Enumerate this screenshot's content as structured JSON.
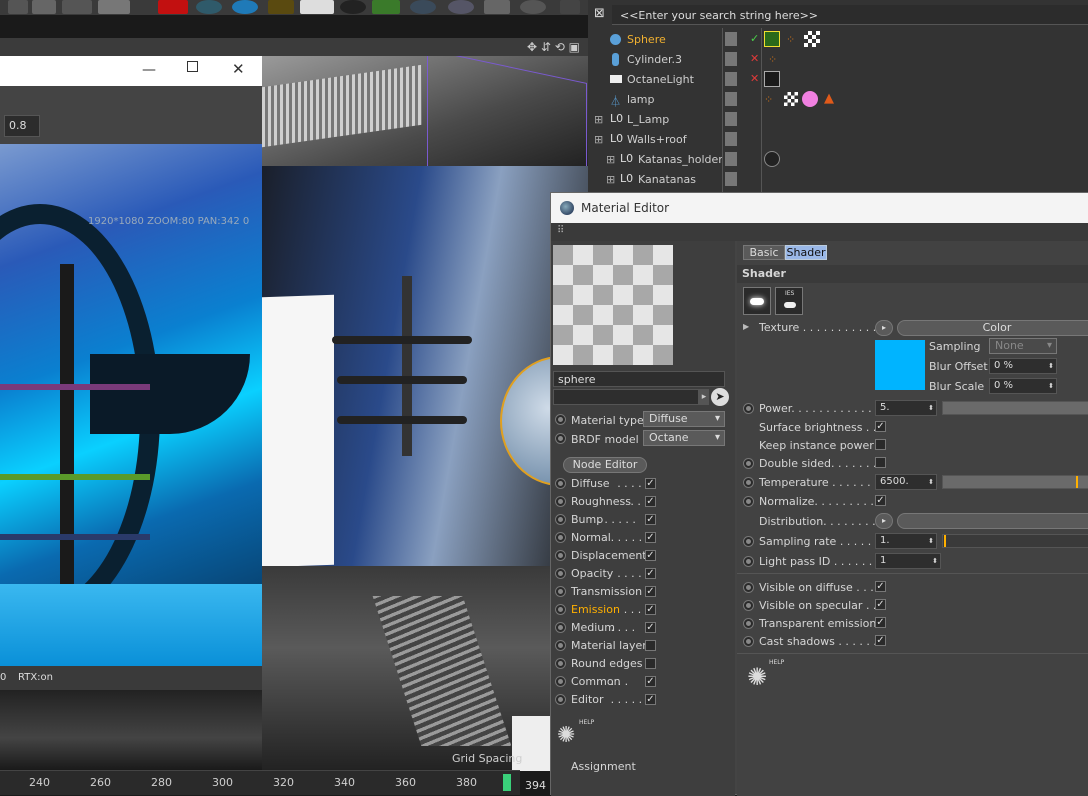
{
  "object_manager": {
    "search_placeholder": "<<Enter your search string here>>",
    "objects": [
      {
        "name": "Sphere",
        "selected": true
      },
      {
        "name": "Cylinder.3"
      },
      {
        "name": "OctaneLight"
      },
      {
        "name": "lamp"
      },
      {
        "name": "L_Lamp"
      },
      {
        "name": "Walls+roof"
      },
      {
        "name": "Katanas_holder"
      },
      {
        "name": "Kanatanas"
      }
    ]
  },
  "render_window": {
    "value_field": "0.8",
    "overlay_text": "1920*1080 ZOOM:80 PAN:342 0",
    "status_left": "0",
    "status_rtx": "RTX:on"
  },
  "viewport": {
    "grid_spacing": "Grid Spacing"
  },
  "timeline": {
    "ticks": [
      "240",
      "260",
      "280",
      "300",
      "320",
      "340",
      "360",
      "380"
    ],
    "current_frame": "394 F"
  },
  "material_editor": {
    "title": "Material Editor",
    "material_name": "sphere",
    "material_type_label": "Material type",
    "material_type_value": "Diffuse",
    "brdf_label": "BRDF model",
    "brdf_value": "Octane",
    "node_editor_label": "Node Editor",
    "channels": [
      {
        "label": "Diffuse",
        "dots": " . . . . .",
        "checked": true
      },
      {
        "label": "Roughness",
        "dots": " . .",
        "checked": true
      },
      {
        "label": "Bump",
        "dots": " . . . . . .",
        "checked": true
      },
      {
        "label": "Normal",
        "dots": " . . . . .",
        "checked": true
      },
      {
        "label": "Displacement",
        "dots": "",
        "checked": true
      },
      {
        "label": "Opacity",
        "dots": " . . . .",
        "checked": true
      },
      {
        "label": "Transmission",
        "dots": "",
        "checked": true
      },
      {
        "label": "Emission",
        "dots": " . . . .",
        "checked": true,
        "active": true
      },
      {
        "label": "Medium",
        "dots": " . . . .",
        "checked": true
      },
      {
        "label": "Material layer",
        "dots": "",
        "checked": false
      },
      {
        "label": "Round edges",
        "dots": "",
        "checked": false
      },
      {
        "label": "Common",
        "dots": " . . .",
        "checked": true
      },
      {
        "label": "Editor",
        "dots": " . . . . . .",
        "checked": true
      }
    ],
    "help_label": "HELP",
    "assignment_label": "Assignment",
    "tabs": [
      "Basic",
      "Shader"
    ],
    "section_title": "Shader",
    "texture_label": "Texture . . . . . . . . . . .",
    "texture_button": "Color",
    "sampling_label": "Sampling",
    "sampling_value": "None",
    "blur_offset_label": "Blur Offset",
    "blur_offset_value": "0 %",
    "blur_scale_label": "Blur Scale",
    "blur_scale_value": "0 %",
    "texture_color": "#00b4ff",
    "power_label": "Power. . . . . . . . . . . . . .",
    "power_value": "5.",
    "surface_brightness_label": "Surface brightness . .",
    "keep_instance_label": "Keep instance power",
    "double_sided_label": "Double sided. . . . . . .",
    "temperature_label": "Temperature . . . . . . .",
    "temperature_value": "6500.",
    "normalize_label": "Normalize. . . . . . . . . .",
    "distribution_label": "Distribution. . . . . . . . .",
    "sampling_rate_label": "Sampling rate . . . . . .",
    "sampling_rate_value": "1.",
    "light_pass_label": "Light pass ID . . . . . .",
    "light_pass_value": "1",
    "vis_diffuse_label": "Visible on diffuse . . . .",
    "vis_specular_label": "Visible on specular . . .",
    "transparent_emission_label": "Transparent emission",
    "cast_shadows_label": "Cast shadows . . . . . . .",
    "help_label2": "HELP",
    "accent_color": "#ffb000"
  }
}
